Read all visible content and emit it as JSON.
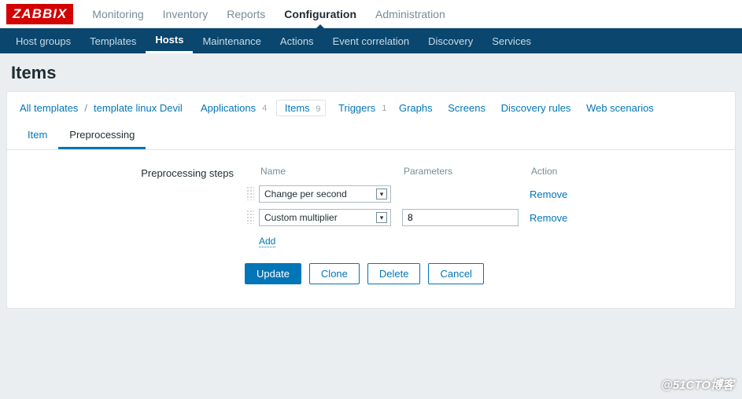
{
  "logo": "ZABBIX",
  "top_nav": {
    "monitoring": "Monitoring",
    "inventory": "Inventory",
    "reports": "Reports",
    "configuration": "Configuration",
    "administration": "Administration"
  },
  "sub_nav": {
    "host_groups": "Host groups",
    "templates": "Templates",
    "hosts": "Hosts",
    "maintenance": "Maintenance",
    "actions": "Actions",
    "event_correlation": "Event correlation",
    "discovery": "Discovery",
    "services": "Services"
  },
  "page_title": "Items",
  "breadcrumb": {
    "all_templates": "All templates",
    "template_name": "template linux Devil",
    "applications": "Applications",
    "applications_count": "4",
    "items": "Items",
    "items_count": "9",
    "triggers": "Triggers",
    "triggers_count": "1",
    "graphs": "Graphs",
    "screens": "Screens",
    "discovery_rules": "Discovery rules",
    "web_scenarios": "Web scenarios"
  },
  "tabs": {
    "item": "Item",
    "preprocessing": "Preprocessing"
  },
  "form": {
    "label": "Preprocessing steps",
    "headers": {
      "name": "Name",
      "parameters": "Parameters",
      "action": "Action"
    },
    "steps": [
      {
        "name": "Change per second",
        "param": "",
        "remove": "Remove"
      },
      {
        "name": "Custom multiplier",
        "param": "8",
        "remove": "Remove"
      }
    ],
    "add": "Add"
  },
  "buttons": {
    "update": "Update",
    "clone": "Clone",
    "delete": "Delete",
    "cancel": "Cancel"
  },
  "watermark": "@51CTO博客"
}
